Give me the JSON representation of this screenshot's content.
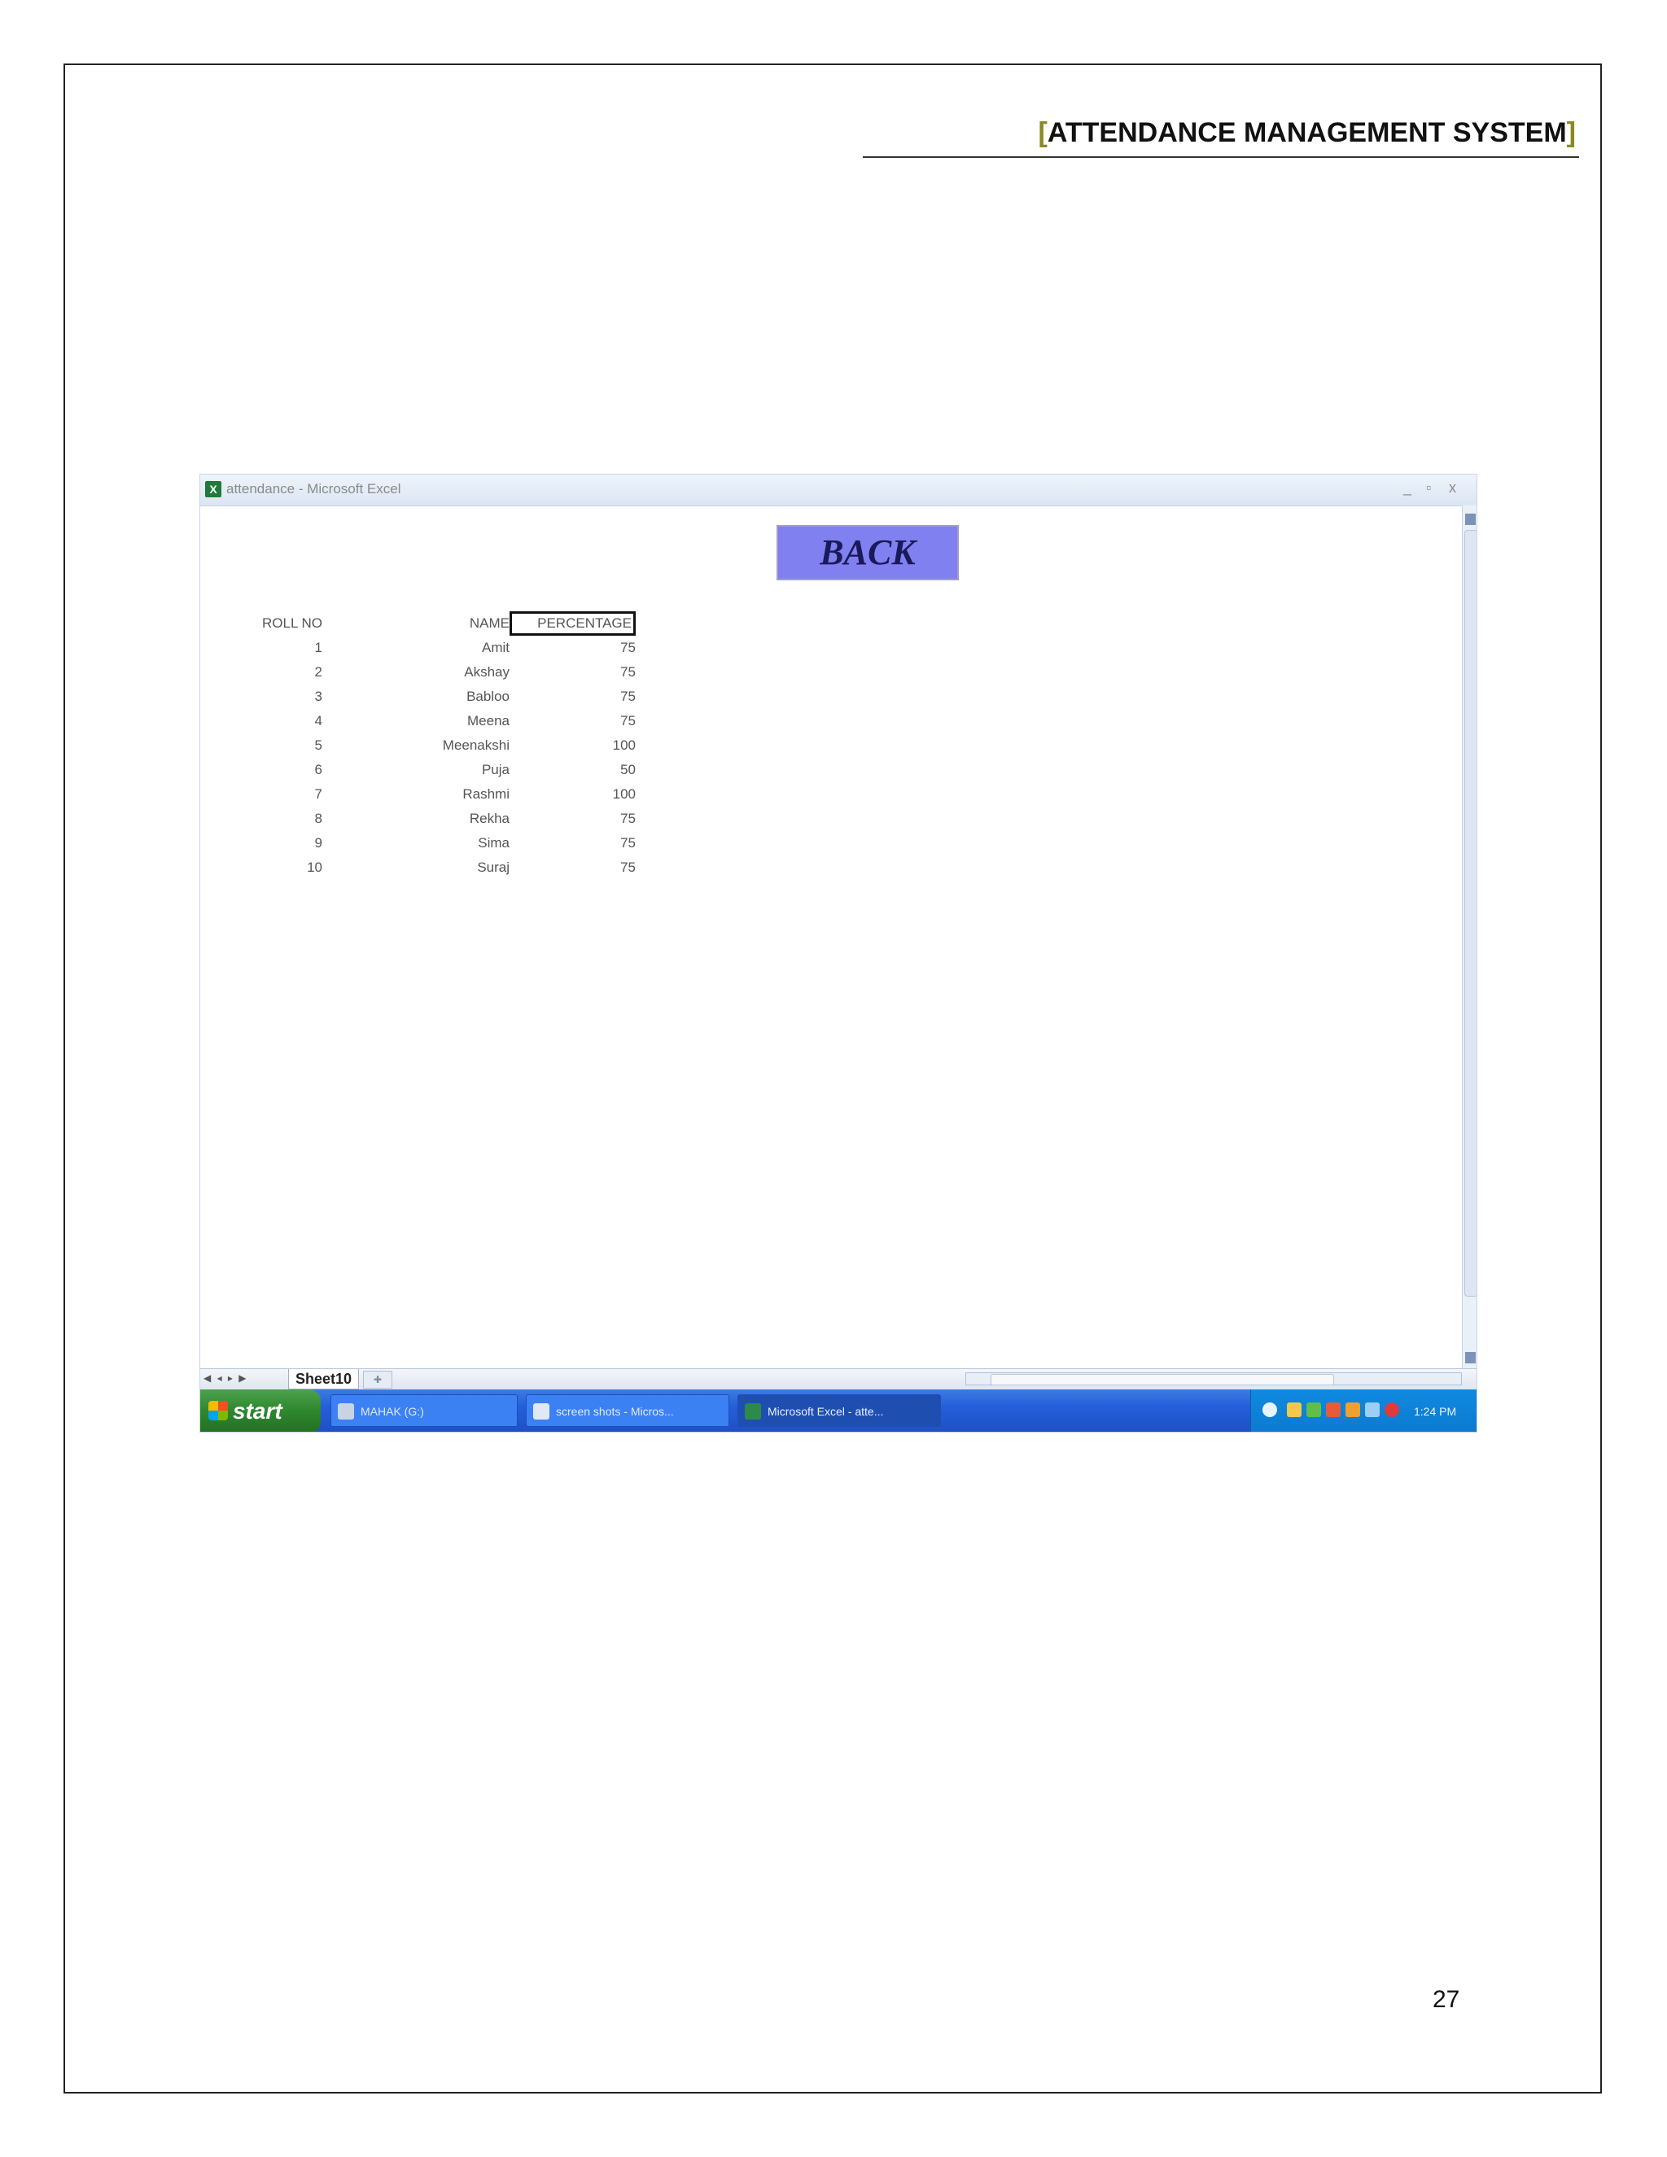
{
  "document": {
    "header": {
      "bracket_open": "[",
      "title": "ATTENDANCE MANAGEMENT SYSTEM",
      "bracket_close": "]"
    },
    "page_number": "27"
  },
  "excel": {
    "window_title": "attendance - Microsoft Excel",
    "window_controls": {
      "minimize": "_",
      "maximize": "▫",
      "close": "x"
    },
    "back_button_label": "BACK",
    "table": {
      "headers": {
        "roll": "ROLL NO",
        "name": "NAME",
        "percentage": "PERCENTAGE"
      },
      "rows": [
        {
          "roll": "1",
          "name": "Amit",
          "percentage": "75"
        },
        {
          "roll": "2",
          "name": "Akshay",
          "percentage": "75"
        },
        {
          "roll": "3",
          "name": "Babloo",
          "percentage": "75"
        },
        {
          "roll": "4",
          "name": "Meena",
          "percentage": "75"
        },
        {
          "roll": "5",
          "name": "Meenakshi",
          "percentage": "100"
        },
        {
          "roll": "6",
          "name": "Puja",
          "percentage": "50"
        },
        {
          "roll": "7",
          "name": "Rashmi",
          "percentage": "100"
        },
        {
          "roll": "8",
          "name": "Rekha",
          "percentage": "75"
        },
        {
          "roll": "9",
          "name": "Sima",
          "percentage": "75"
        },
        {
          "roll": "10",
          "name": "Suraj",
          "percentage": "75"
        }
      ]
    },
    "sheet_tab": "Sheet10"
  },
  "taskbar": {
    "start_label": "start",
    "tasks": [
      {
        "label": "MAHAK (G:)"
      },
      {
        "label": "screen shots - Micros..."
      },
      {
        "label": "Microsoft Excel - atte..."
      }
    ],
    "clock": "1:24 PM"
  }
}
